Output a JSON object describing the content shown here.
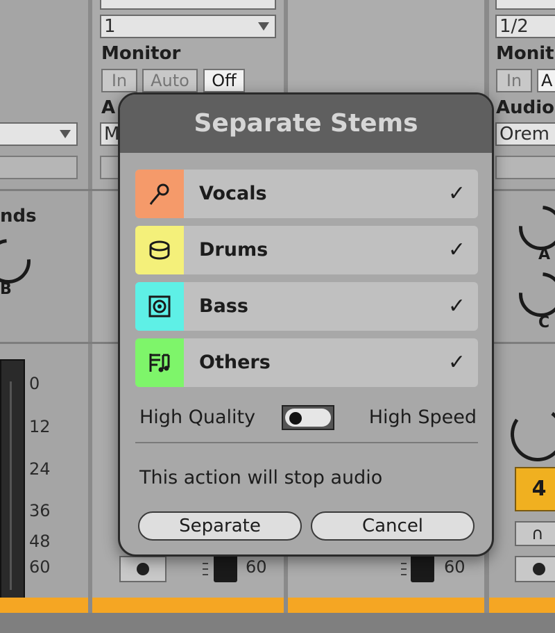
{
  "background": {
    "track_b": {
      "input_select": "1",
      "monitor_label": "Monitor",
      "monitor_buttons": [
        "In",
        "Auto",
        "Off"
      ],
      "monitor_active": "Off",
      "audio_to_label_partial": "A",
      "audio_to_select_partial": "M"
    },
    "track_d": {
      "input_select": "1/2",
      "monitor_label_partial": "Monit",
      "monitor_buttons_partial": [
        "In",
        "A"
      ],
      "audio_to_label_partial": "Audio",
      "audio_to_select_partial": "Orem"
    },
    "sends_label_partial": "nds",
    "knob_letters": [
      "B",
      "A",
      "C"
    ],
    "meter_scale": [
      "0",
      "12",
      "24",
      "36",
      "48",
      "60"
    ],
    "fader_values": [
      "60",
      "60"
    ],
    "track_number": "4",
    "colors": {
      "strip": "#f5a623",
      "track_number_bg": "#f0b020"
    }
  },
  "dialog": {
    "title": "Separate Stems",
    "stems": [
      {
        "label": "Vocals",
        "icon": "microphone-icon",
        "color": "#f59a6a",
        "checked": true,
        "check": "✓"
      },
      {
        "label": "Drums",
        "icon": "drum-icon",
        "color": "#f4f07a",
        "checked": true,
        "check": "✓"
      },
      {
        "label": "Bass",
        "icon": "speaker-icon",
        "color": "#5ef0e6",
        "checked": true,
        "check": "✓"
      },
      {
        "label": "Others",
        "icon": "sheet-music-icon",
        "color": "#7ef56a",
        "checked": true,
        "check": "✓"
      }
    ],
    "quality_left": "High Quality",
    "quality_right": "High Speed",
    "quality_toggle_on_speed": false,
    "warning": "This action will stop audio",
    "separate_label": "Separate",
    "cancel_label": "Cancel"
  }
}
